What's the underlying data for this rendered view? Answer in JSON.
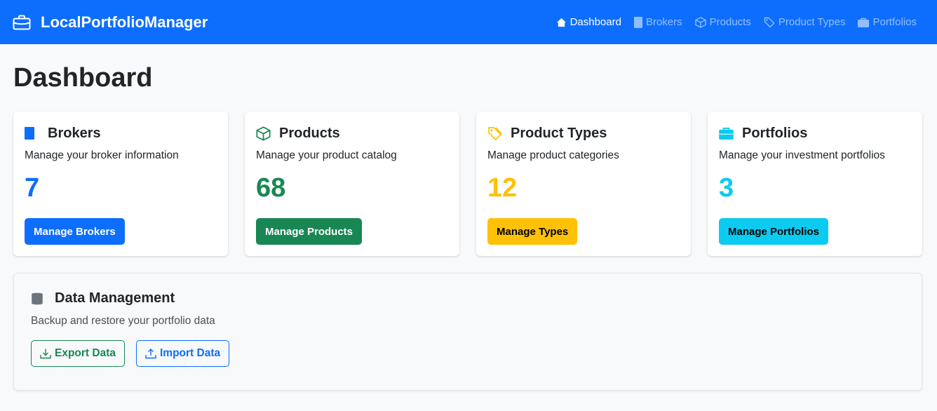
{
  "app": {
    "brand": "LocalPortfolioManager"
  },
  "nav": {
    "items": [
      {
        "label": "Dashboard",
        "icon": "house-icon",
        "active": true
      },
      {
        "label": "Brokers",
        "icon": "bookmark-icon",
        "active": false
      },
      {
        "label": "Products",
        "icon": "box-icon",
        "active": false
      },
      {
        "label": "Product Types",
        "icon": "tags-icon",
        "active": false
      },
      {
        "label": "Portfolios",
        "icon": "briefcase-icon",
        "active": false
      }
    ]
  },
  "page": {
    "title": "Dashboard"
  },
  "cards": [
    {
      "title": "Brokers",
      "description": "Manage your broker information",
      "count": "7",
      "button": "Manage Brokers",
      "icon": "bookmark-icon",
      "color": "#0d6efd",
      "button_text_color": "#ffffff"
    },
    {
      "title": "Products",
      "description": "Manage your product catalog",
      "count": "68",
      "button": "Manage Products",
      "icon": "box-icon",
      "color": "#198754",
      "button_text_color": "#ffffff"
    },
    {
      "title": "Product Types",
      "description": "Manage product categories",
      "count": "12",
      "button": "Manage Types",
      "icon": "tags-icon",
      "color": "#ffc107",
      "button_text_color": "#000000"
    },
    {
      "title": "Portfolios",
      "description": "Manage your investment portfolios",
      "count": "3",
      "button": "Manage Portfolios",
      "icon": "briefcase-icon",
      "color": "#0dcaf0",
      "button_text_color": "#000000"
    }
  ],
  "data_management": {
    "title": "Data Management",
    "description": "Backup and restore your portfolio data",
    "export_label": "Export Data",
    "import_label": "Import Data",
    "icon": "database-icon",
    "export_color": "#198754",
    "import_color": "#0d6efd"
  }
}
